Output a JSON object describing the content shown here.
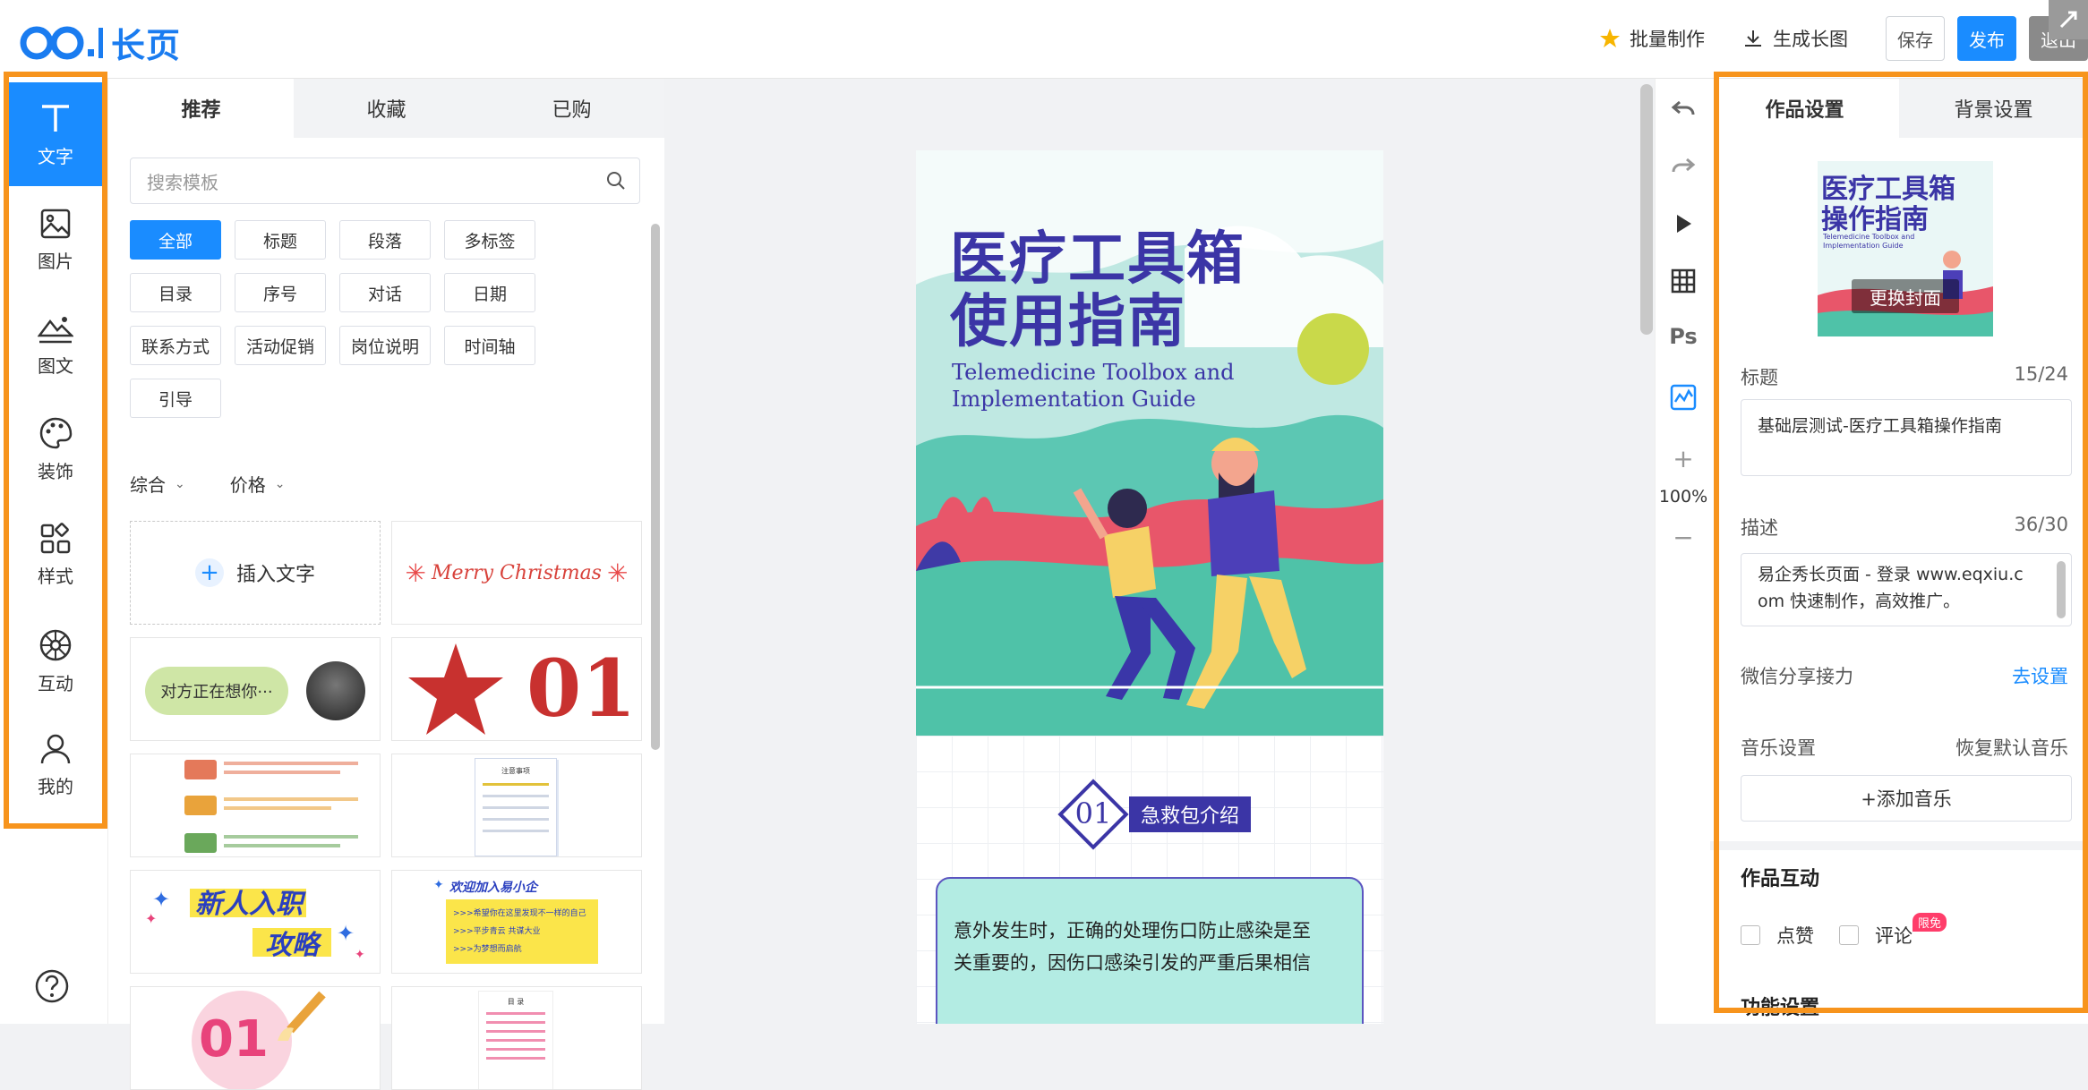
{
  "brand": {
    "logo_text": "长页",
    "accent": "#1a8cff",
    "highlight": "#f7941d"
  },
  "topbar": {
    "batch_label": "批量制作",
    "longimg_label": "生成长图",
    "save_label": "保存",
    "publish_label": "发布",
    "exit_label": "退出"
  },
  "leftnav": {
    "items": [
      {
        "label": "文字",
        "icon": "text-icon"
      },
      {
        "label": "图片",
        "icon": "image-icon"
      },
      {
        "label": "图文",
        "icon": "image-text-icon"
      },
      {
        "label": "装饰",
        "icon": "palette-icon"
      },
      {
        "label": "样式",
        "icon": "style-icon"
      },
      {
        "label": "互动",
        "icon": "interaction-icon"
      },
      {
        "label": "我的",
        "icon": "user-icon"
      }
    ]
  },
  "templates": {
    "tabs": [
      "推荐",
      "收藏",
      "已购"
    ],
    "search_placeholder": "搜索模板",
    "chips": [
      "全部",
      "标题",
      "段落",
      "多标签",
      "目录",
      "序号",
      "对话",
      "日期",
      "联系方式",
      "活动促销",
      "岗位说明",
      "时间轴",
      "引导"
    ],
    "filters": [
      "综合",
      "价格"
    ],
    "insert_text": "插入文字",
    "t_christmas": "Merry Christmas",
    "t_chat": "对方正在想你···",
    "t_number": "01",
    "t_newbie_1": "新人入职",
    "t_newbie_2": "攻略",
    "t_welcome": "欢迎加入易小企",
    "t_welcome_lines": [
      ">>>希望你在这里发现不一样的自己",
      ">>>平步青云 共谋大业",
      ">>>为梦想而启航"
    ],
    "t_notice": "注意事项",
    "t_catalog": "目 录",
    "t_pink_number": "01"
  },
  "canvas": {
    "title_line1": "医疗工具箱",
    "title_line2": "使用指南",
    "subtitle_line1": "Telemedicine Toolbox and",
    "subtitle_line2": "Implementation Guide",
    "section_number": "01",
    "section_title": "急救包介绍",
    "body_line1": "意外发生时，正确的处理伤口防止感染是至",
    "body_line2": "关重要的，因伤口感染引发的严重后果相信",
    "zoom": "100%"
  },
  "right": {
    "tabs": [
      "作品设置",
      "背景设置"
    ],
    "cover_title_line1": "医疗工具箱",
    "cover_title_line2": "操作指南",
    "cover_subtitle": "Telemedicine Toolbox and Implementation Guide",
    "change_cover": "更换封面",
    "title_label": "标题",
    "title_count": "15/24",
    "title_value": "基础层测试-医疗工具箱操作指南",
    "desc_label": "描述",
    "desc_count": "36/30",
    "desc_value_line1": "易企秀长页面 - 登录 www.eqxiu.c",
    "desc_value_line2": "om 快速制作，高效推广。",
    "wechat_label": "微信分享接力",
    "wechat_link": "去设置",
    "music_label": "音乐设置",
    "music_reset": "恢复默认音乐",
    "add_music": "+添加音乐",
    "interaction_title": "作品互动",
    "like_label": "点赞",
    "comment_label": "评论",
    "free_badge": "限免",
    "feature_title": "功能设置"
  }
}
